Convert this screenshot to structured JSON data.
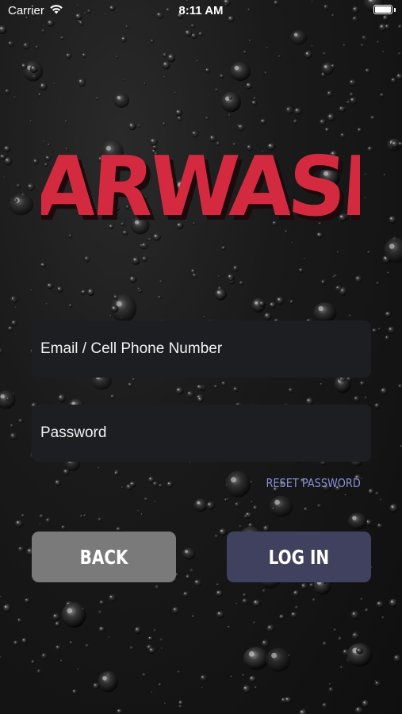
{
  "status_bar": {
    "carrier": "Carrier",
    "time": "8:11 AM",
    "wifi_icon": "wifi-icon",
    "battery_icon": "battery-icon"
  },
  "logo": {
    "text": "CARWASH",
    "color": "#d42a40",
    "shadow_color": "#1c0a0c"
  },
  "form": {
    "email_placeholder": "Email / Cell Phone Number",
    "email_value": "",
    "password_placeholder": "Password",
    "password_value": "",
    "reset_label": "RESET PASSWORD"
  },
  "buttons": {
    "back_label": "BACK",
    "login_label": "LOG IN"
  },
  "colors": {
    "background": "#151515",
    "field_bg": "#1d1e22",
    "back_button": "#7a7a7a",
    "login_button": "#40405f",
    "reset_link": "#8a8ed8"
  }
}
